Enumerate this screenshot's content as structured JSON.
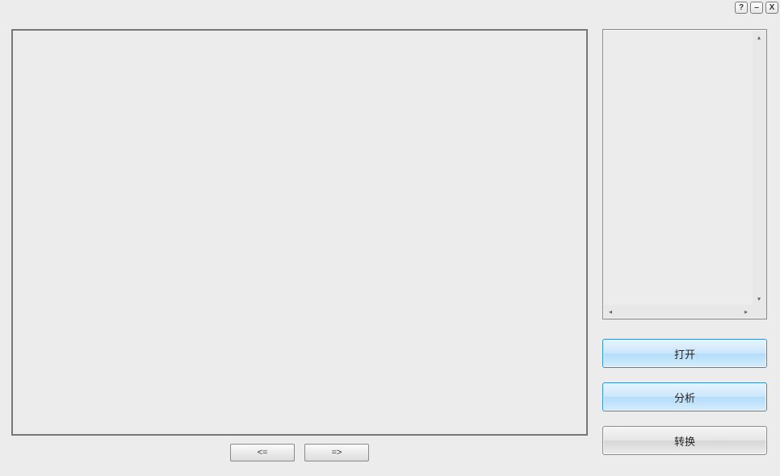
{
  "titlebar": {
    "help_label": "?",
    "minimize_label": "–",
    "close_label": "X"
  },
  "nav": {
    "prev_label": "<=",
    "next_label": "=>"
  },
  "actions": {
    "open_label": "打开",
    "analyze_label": "分析",
    "convert_label": "转换"
  },
  "scroll": {
    "up_glyph": "▴",
    "down_glyph": "▾",
    "left_glyph": "◂",
    "right_glyph": "▸"
  }
}
